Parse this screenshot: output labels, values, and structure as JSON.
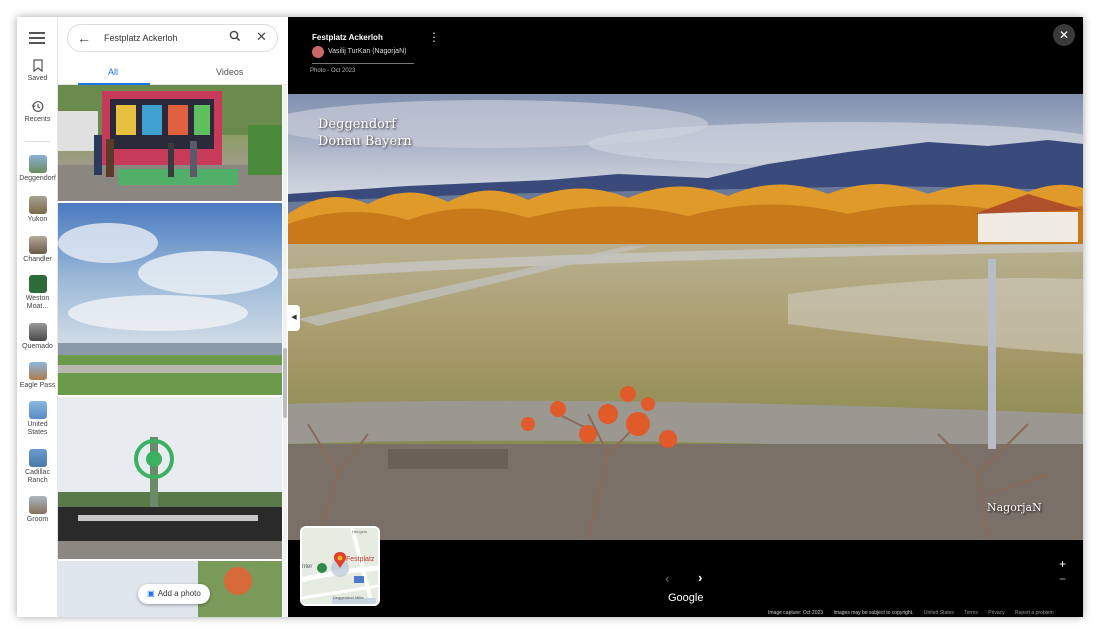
{
  "rail": {
    "saved": "Saved",
    "recents": "Recents",
    "places": [
      {
        "label": "Deggendorf",
        "color": "#6b8e5a"
      },
      {
        "label": "Yukon",
        "color": "#7a6a4a"
      },
      {
        "label": "Chandler",
        "color": "#8a7a66"
      },
      {
        "label": "Weston Moat...",
        "color": "#2e6b3a"
      },
      {
        "label": "Quemado",
        "color": "#5a5a5a"
      },
      {
        "label": "Eagle Pass",
        "color": "#b07a4a"
      },
      {
        "label": "United States",
        "color": "#5a8ac8"
      },
      {
        "label": "Cadillac Ranch",
        "color": "#4a7aa8"
      },
      {
        "label": "Groom",
        "color": "#8a7058"
      }
    ]
  },
  "search": {
    "query": "Festplatz Ackerloh",
    "back_icon": "arrow-left-icon",
    "search_icon": "search-icon",
    "clear_icon": "close-icon"
  },
  "tabs": {
    "all": "All",
    "videos": "Videos"
  },
  "add_photo": "Add a photo",
  "viewer": {
    "title": "Festplatz Ackerloh",
    "author": "Vasilij TurKan (NagorjaN)",
    "date": "Photo - Oct 2023",
    "overlay_line1": "Deggendorf",
    "overlay_line2": "Donau Bayern",
    "watermark": "NagorjaN",
    "brand": "Google",
    "map_label": "Festplatz",
    "map_label2": "nter",
    "map_label3": "Deggendorf Mitte",
    "map_road": "Hengers",
    "footer": {
      "capture": "Image capture: Oct 2023",
      "copyright": "Images may be subject to copyright.",
      "country": "United States",
      "terms": "Terms",
      "privacy": "Privacy",
      "report": "Report a problem"
    }
  }
}
